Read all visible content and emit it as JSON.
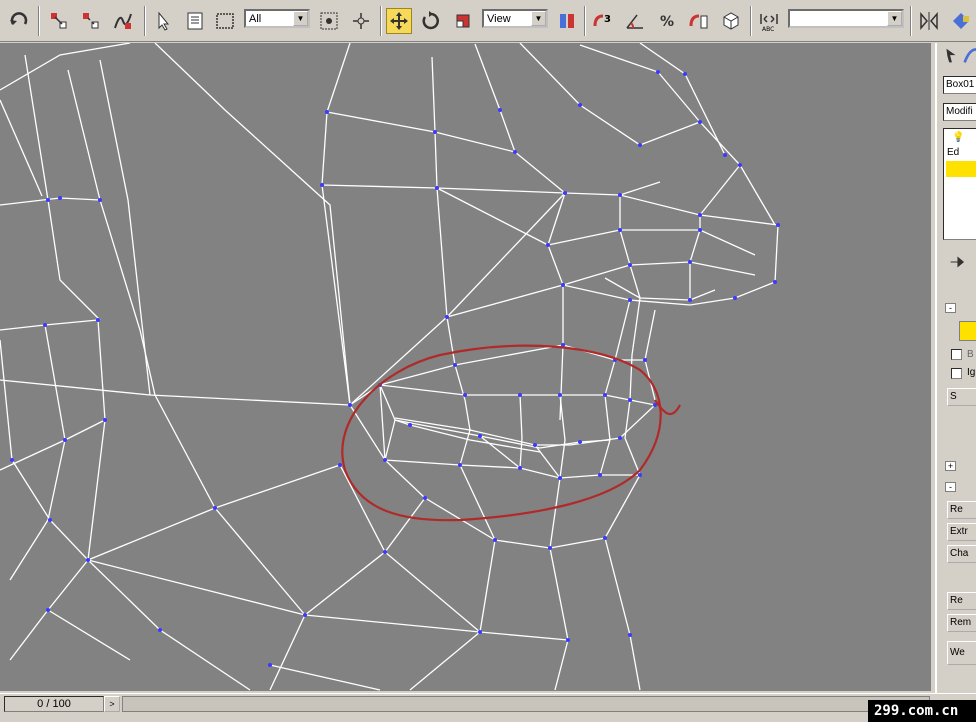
{
  "toolbar": {
    "selection_filter": "All",
    "coord_system": "View",
    "named_selection": "",
    "icons": [
      "undo-icon",
      "select-link-icon",
      "unlink-icon",
      "bind-spacewarp-icon",
      "select-icon",
      "select-by-name-icon",
      "rect-region-icon",
      "window-crossing-icon",
      "move-icon",
      "rotate-icon",
      "scale-icon",
      "mirror-icon",
      "align-icon",
      "snap-3d-icon",
      "angle-snap-icon",
      "percent-snap-icon",
      "spinner-snap-icon",
      "named-selection-icon",
      "mirror-abc-icon",
      "render-icon"
    ]
  },
  "command_panel": {
    "object_name": "Box01",
    "modifier_list": "Modifi",
    "stack_item": "Ed",
    "buttons": [
      "S",
      "Re",
      "Extr",
      "Cha",
      "Re",
      "Rem",
      "We"
    ],
    "checks": [
      "B",
      "Ig"
    ]
  },
  "status": {
    "frame": "0 / 100",
    "next": ">"
  },
  "watermark": "299.com.cn",
  "colors": {
    "viewport_bg": "#828282",
    "wire": "#ffffff",
    "vertex": "#3b3bff",
    "annotation": "#b02a2a",
    "active_tool": "#f7d95a"
  }
}
